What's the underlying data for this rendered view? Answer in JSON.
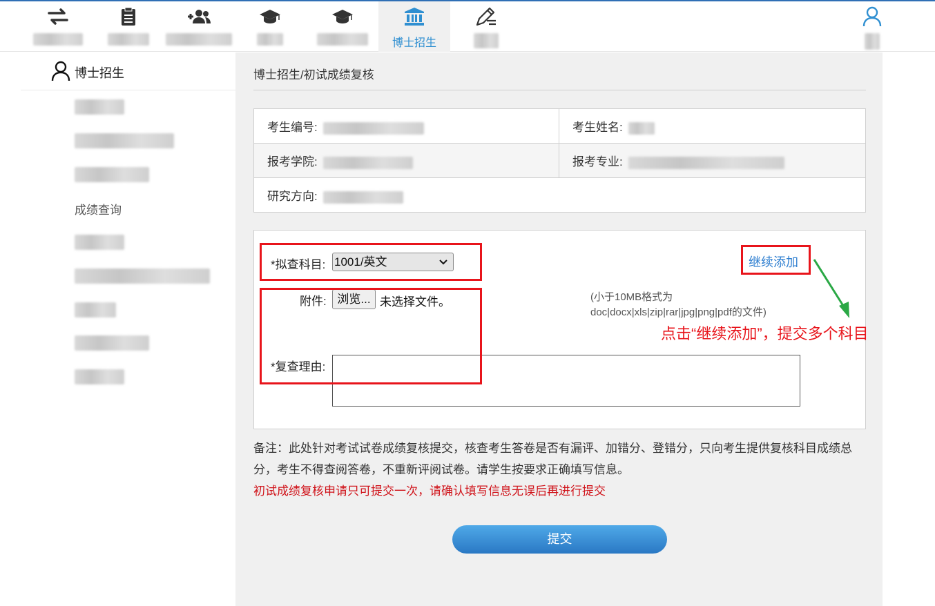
{
  "nav": {
    "items": [
      {
        "icon": "transfer-icon",
        "label": ""
      },
      {
        "icon": "clipboard-icon",
        "label": ""
      },
      {
        "icon": "add-users-icon",
        "label": ""
      },
      {
        "icon": "graduation-cap-icon",
        "label": ""
      },
      {
        "icon": "graduation-cap-icon",
        "label": ""
      },
      {
        "icon": "institution-icon",
        "label": "博士招生"
      },
      {
        "icon": "edit-pen-icon",
        "label": ""
      }
    ],
    "user_icon": "user-icon"
  },
  "sidebar": {
    "title": "博士招生",
    "visible_item": "成绩查询"
  },
  "main": {
    "breadcrumb": "博士招生/初试成绩复核",
    "info": {
      "exam_no_label": "考生编号:",
      "name_label": "考生姓名:",
      "college_label": "报考学院:",
      "major_label": "报考专业:",
      "direction_label": "研究方向:"
    },
    "form": {
      "subject_label": "*拟查科目:",
      "subject_value": "1001/英文",
      "attachment_label": "附件:",
      "browse_label": "浏览...",
      "no_file_text": "未选择文件。",
      "file_hint": "(小于10MB格式为doc|docx|xls|zip|rar|jpg|png|pdf的文件)",
      "reason_label": "*复查理由:",
      "add_more": "继续添加"
    },
    "annotation": "点击“继续添加”，提交多个科目",
    "note": "备注：此处针对考试试卷成绩复核提交，核查考生答卷是否有漏评、加错分、登错分，只向考生提供复核科目成绩总分，考生不得查阅答卷，不重新评阅试卷。请学生按要求正确填写信息。",
    "warning": "初试成绩复核申请只可提交一次，请确认填写信息无误后再进行提交",
    "submit_label": "提交"
  },
  "colors": {
    "accent": "#2f8fd1",
    "warning_red": "#d0141b",
    "highlight_red": "#e8141b",
    "arrow_green": "#2aa845"
  }
}
